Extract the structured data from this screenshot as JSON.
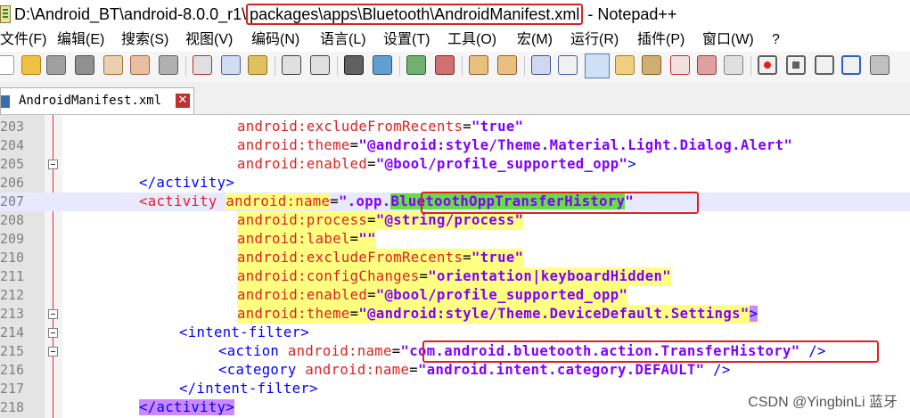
{
  "title": {
    "prefix": "D:\\Android_BT\\android-8.0.0_r1\\",
    "highlighted": "packages\\apps\\Bluetooth\\AndroidManifest.xml",
    "suffix": " - Notepad++"
  },
  "menu": [
    "文件(F)",
    "编辑(E)",
    "搜索(S)",
    "视图(V)",
    "编码(N)",
    "语言(L)",
    "设置(T)",
    "工具(O)",
    "宏(M)",
    "运行(R)",
    "插件(P)",
    "窗口(W)",
    "?"
  ],
  "tab": {
    "label": "AndroidManifest.xml",
    "close": "✕"
  },
  "code": {
    "l203": {
      "num": "203",
      "attr": "android:excludeFromRecents",
      "eq": "=",
      "val": "\"true\""
    },
    "l204": {
      "num": "204",
      "attr": "android:theme",
      "eq": "=",
      "val": "\"@android:style/Theme.Material.Light.Dialog.Alert\""
    },
    "l205": {
      "num": "205",
      "attr": "android:enabled",
      "eq": "=",
      "val": "\"@bool/profile_supported_opp\"",
      "close": ">"
    },
    "l206": {
      "num": "206",
      "tag": "</activity>"
    },
    "l207": {
      "num": "207",
      "tag": "<activity",
      "attr": "android:name",
      "eq": "=",
      "val1": "\".opp.",
      "val2": "BluetoothOppTransferHistory",
      "val3": "\""
    },
    "l208": {
      "num": "208",
      "attr": "android:process",
      "eq": "=",
      "val": "\"@string/process\""
    },
    "l209": {
      "num": "209",
      "attr": "android:label",
      "eq": "=",
      "val": "\"\""
    },
    "l210": {
      "num": "210",
      "attr": "android:excludeFromRecents",
      "eq": "=",
      "val": "\"true\""
    },
    "l211": {
      "num": "211",
      "attr": "android:configChanges",
      "eq": "=",
      "val": "\"orientation|keyboardHidden\""
    },
    "l212": {
      "num": "212",
      "attr": "android:enabled",
      "eq": "=",
      "val": "\"@bool/profile_supported_opp\""
    },
    "l213": {
      "num": "213",
      "attr": "android:theme",
      "eq": "=",
      "val": "\"@android:style/Theme.DeviceDefault.Settings\"",
      "close": ">"
    },
    "l214": {
      "num": "214",
      "tag": "<intent-filter>"
    },
    "l215": {
      "num": "215",
      "tag": "<action",
      "attr": "android:name",
      "eq": "=",
      "val": "\"com.android.bluetooth.action.TransferHistory\"",
      "close": "/>"
    },
    "l216": {
      "num": "216",
      "tag": "<category",
      "attr": "android:name",
      "eq": "=",
      "val": "\"android.intent.category.DEFAULT\"",
      "close": "/>"
    },
    "l217": {
      "num": "217",
      "tag": "</intent-filter>"
    },
    "l218": {
      "num": "218",
      "tag": "</activity>"
    }
  },
  "watermark": "CSDN @YingbinLi 蓝牙",
  "colors": {
    "attr": "#e02020",
    "value": "#8000ff",
    "tag": "#0000ff",
    "current_line": "#e8e8ff",
    "highlight_red": "#e02020"
  }
}
